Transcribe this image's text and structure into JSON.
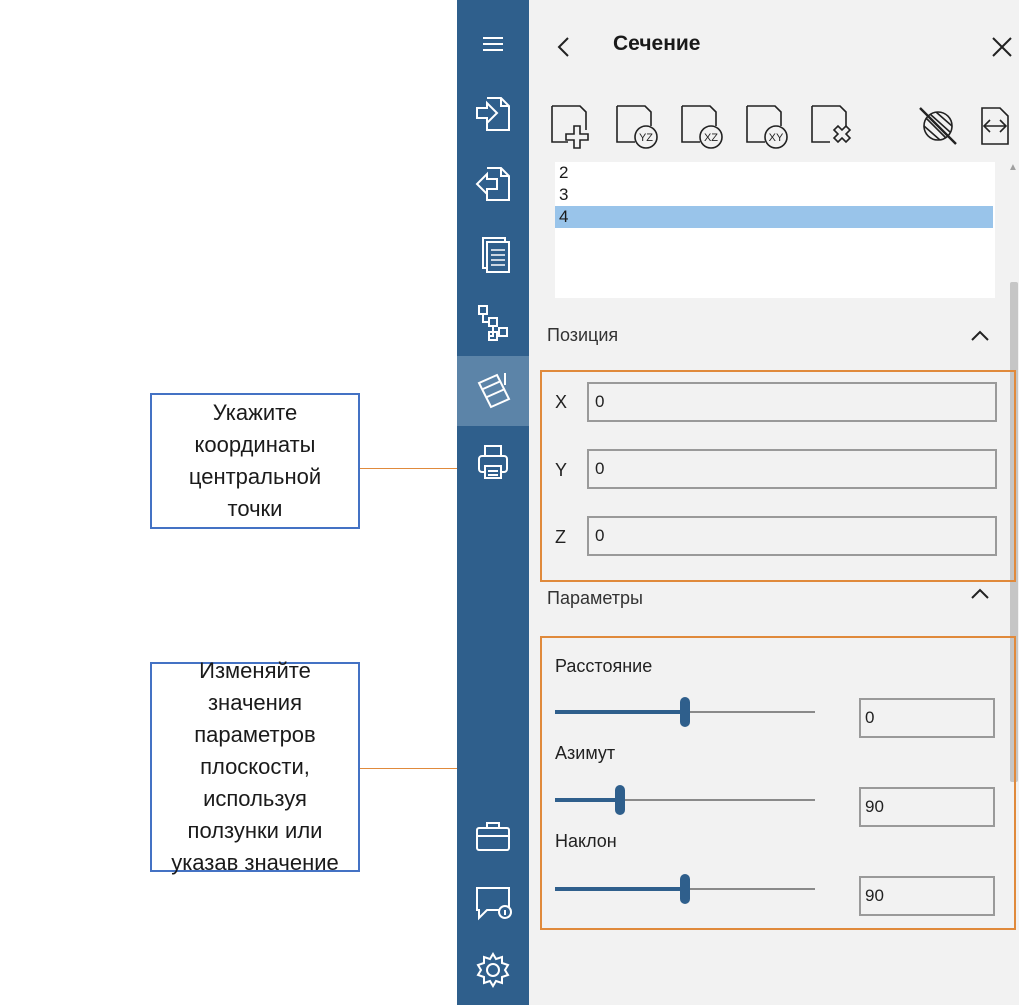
{
  "panel": {
    "title": "Сечение",
    "list_items": [
      "2",
      "3",
      "4"
    ],
    "selected_index": 2,
    "position_section": "Позиция",
    "params_section": "Параметры",
    "coords": [
      {
        "label": "X",
        "value": "0"
      },
      {
        "label": "Y",
        "value": "0"
      },
      {
        "label": "Z",
        "value": "0"
      }
    ],
    "params": [
      {
        "label": "Расстояние",
        "value": "0",
        "slider_fraction": 0.5
      },
      {
        "label": "Азимут",
        "value": "90",
        "slider_fraction": 0.25
      },
      {
        "label": "Наклон",
        "value": "90",
        "slider_fraction": 0.5
      }
    ]
  },
  "sidebar": {
    "icons": [
      "menu-icon",
      "import-icon",
      "export-icon",
      "document-icon",
      "tree-icon",
      "section-tool-icon",
      "print-icon",
      "briefcase-icon",
      "feedback-icon",
      "settings-icon"
    ],
    "active": "section-tool-icon"
  },
  "toolbar": {
    "icons": [
      "add-section-icon",
      "section-yz-icon",
      "section-xz-icon",
      "section-xy-icon",
      "delete-section-icon",
      "hide-section-icon",
      "flip-section-icon"
    ]
  },
  "callouts": {
    "coords_text": "Укажите координаты центральной точки",
    "params_text": "Изменяйте значения параметров плоскости, используя ползунки или указав значение"
  },
  "colors": {
    "sidebar": "#2f5f8c",
    "accent_orange": "#e08a3c",
    "callout_border": "#4472c4",
    "selection": "#99c4ea"
  }
}
